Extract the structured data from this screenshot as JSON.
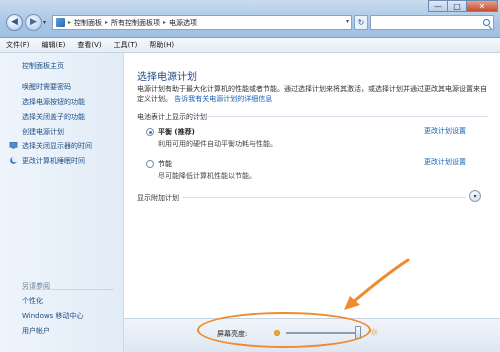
{
  "window": {
    "breadcrumb": [
      "控制面板",
      "所有控制面板项",
      "电源选项"
    ],
    "buttons": {
      "minimize": "—",
      "maximize": "□",
      "close": "✕"
    }
  },
  "menu": [
    "文件(F)",
    "编辑(E)",
    "查看(V)",
    "工具(T)",
    "帮助(H)"
  ],
  "sidebar": {
    "home": "控制面板主页",
    "items": [
      "唤醒时需要密码",
      "选择电源按钮的功能",
      "选择关闭盖子的功能",
      "创建电源计划",
      "选择关闭显示器的时间",
      "更改计算机睡眠时间"
    ],
    "see_also": {
      "label": "另请参阅",
      "items": [
        "个性化",
        "Windows 移动中心",
        "用户帐户"
      ]
    }
  },
  "main": {
    "title": "选择电源计划",
    "description": "电源计划有助于最大化计算机的性能或者节能。通过选择计划来将其激活，或选择计划并通过更改其电源设置来自定义计划。",
    "description_link": "告诉我有关电源计划的详细信息",
    "section_label": "电池表计上显示的计划",
    "plans": [
      {
        "name": "平衡 (推荐)",
        "desc": "利用可用的硬件自动平衡功耗与性能。",
        "selected": true,
        "link": "更改计划设置"
      },
      {
        "name": "节能",
        "desc": "尽可能降低计算机性能以节能。",
        "selected": false,
        "link": "更改计划设置"
      }
    ],
    "extra_plans_label": "显示附加计划"
  },
  "brightness": {
    "label": "屏幕亮度:",
    "level_percent": 100
  },
  "colors": {
    "accent": "#1a5fb4",
    "highlight": "#f08a2d",
    "title": "#1e4a86"
  }
}
